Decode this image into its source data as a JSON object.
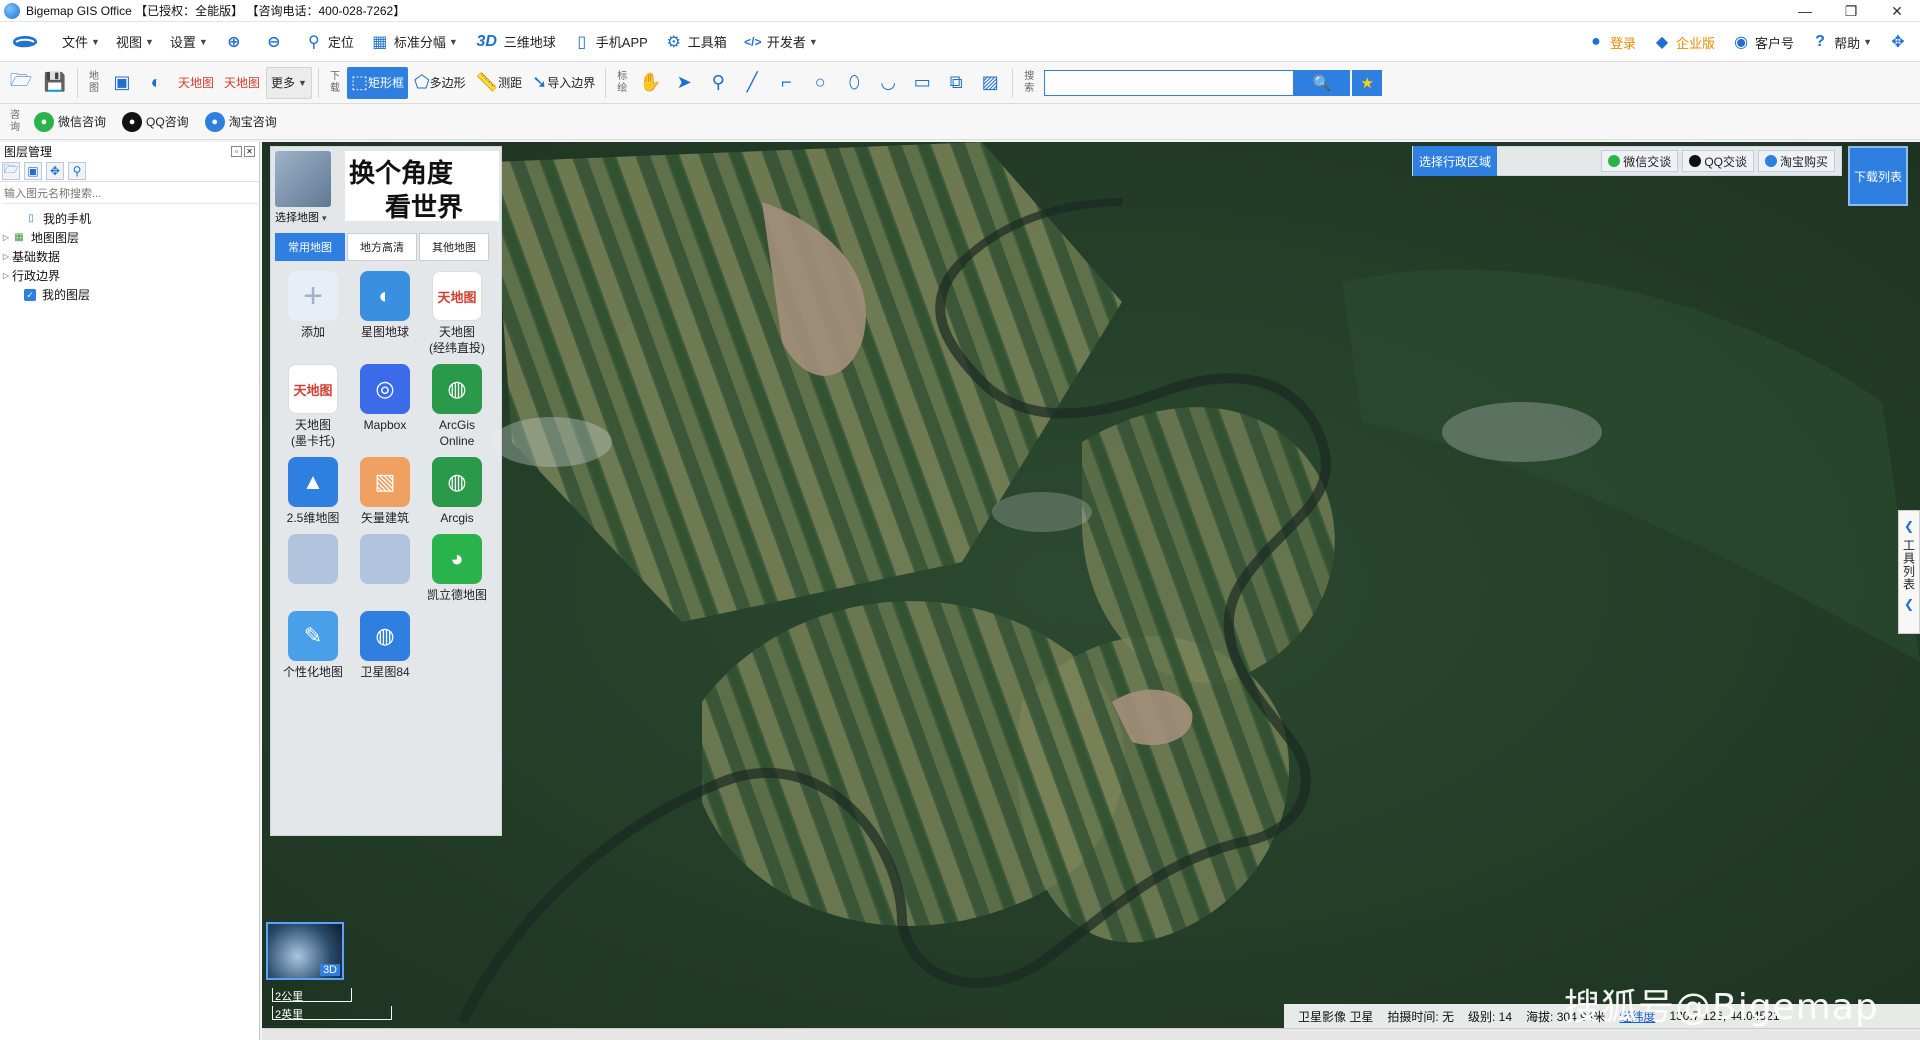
{
  "window": {
    "title": "Bigemap GIS Office 【已授权：全能版】 【咨询电话：400-028-7262】",
    "controls": [
      "—",
      "❐",
      "✕"
    ]
  },
  "menu": {
    "file": "文件",
    "view": "视图",
    "settings": "设置",
    "locate": "定位",
    "standard_sheet": "标准分幅",
    "three_d_mark": "3D",
    "three_d_earth": "三维地球",
    "mobile_app": "手机APP",
    "toolbox": "工具箱",
    "developer": "开发者",
    "login": "登录",
    "enterprise": "企业版",
    "account": "客户号",
    "help": "帮助"
  },
  "toolbar": {
    "map_label": "地图",
    "more": "更多",
    "download_label": "下载",
    "rectangle": "矩形框",
    "polygon": "多边形",
    "measure": "测距",
    "import_boundary": "导入边界",
    "draw_label": "标绘",
    "search_label": "搜索",
    "search_placeholder": ""
  },
  "consult": {
    "label": "咨询",
    "wechat": "微信咨询",
    "qq": "QQ咨询",
    "taobao": "淘宝咨询"
  },
  "layer_panel": {
    "title": "图层管理",
    "search_placeholder": "输入图元名称搜索...",
    "items": [
      {
        "label": "我的手机"
      },
      {
        "label": "地图图层"
      },
      {
        "label": "基础数据"
      },
      {
        "label": "行政边界"
      },
      {
        "label": "我的图层"
      }
    ]
  },
  "map_panel": {
    "select_map": "选择地图",
    "calligraphy_line1": "换个角度",
    "calligraphy_line2": "看世界",
    "tabs": [
      "常用地图",
      "地方高清",
      "其他地图"
    ],
    "items": [
      {
        "label": "添加",
        "icon": "plus-icon",
        "color": "#e8eef6"
      },
      {
        "label": "星图地球",
        "icon": "star-earth-icon",
        "color": "#3a8fe0"
      },
      {
        "label": "天地图\n(经纬直投)",
        "icon": "tianditu-icon",
        "color": "#ffffff"
      },
      {
        "label": "天地图\n(墨卡托)",
        "icon": "tianditu-icon",
        "color": "#ffffff"
      },
      {
        "label": "Mapbox",
        "icon": "mapbox-icon",
        "color": "#3b6be8"
      },
      {
        "label": "ArcGis\nOnline",
        "icon": "globe-icon",
        "color": "#2a9a4a"
      },
      {
        "label": "2.5维地图",
        "icon": "map-25d-icon",
        "color": "#2f7fe0"
      },
      {
        "label": "矢量建筑",
        "icon": "vector-building-icon",
        "color": "#f0a060"
      },
      {
        "label": "Arcgis",
        "icon": "globe-icon",
        "color": "#2a9a4a"
      },
      {
        "label": "",
        "icon": "blurred-icon",
        "color": "#b0c4de"
      },
      {
        "label": "",
        "icon": "blurred-icon",
        "color": "#b0c4de"
      },
      {
        "label": "凯立德地图",
        "icon": "kailide-icon",
        "color": "#2bb34b"
      },
      {
        "label": "个性化地图",
        "icon": "custom-map-icon",
        "color": "#4aa0e8"
      },
      {
        "label": "卫星图84",
        "icon": "satellite-globe-icon",
        "color": "#2f7fe0"
      }
    ]
  },
  "admin_bar": {
    "select_region": "选择行政区域",
    "wechat": "微信交谈",
    "qq": "QQ交谈",
    "taobao": "淘宝购买"
  },
  "download_list": "下载列表",
  "right_toolbar": "工具列表",
  "mini_map_badge": "3D",
  "scale": {
    "km": "2公里",
    "mi": "2英里"
  },
  "status": {
    "source": "卫星影像 卫星",
    "capture_time": "拍摄时间: 无",
    "level": "级别:  14",
    "altitude": "海拔: 304.94米",
    "lnglat_link": "经纬度",
    "coords": "130.7 126, 44.04521"
  },
  "watermark": "搜狐号@Bigemap",
  "colors": {
    "accent": "#2f7fe0",
    "orange": "#f08a00"
  }
}
